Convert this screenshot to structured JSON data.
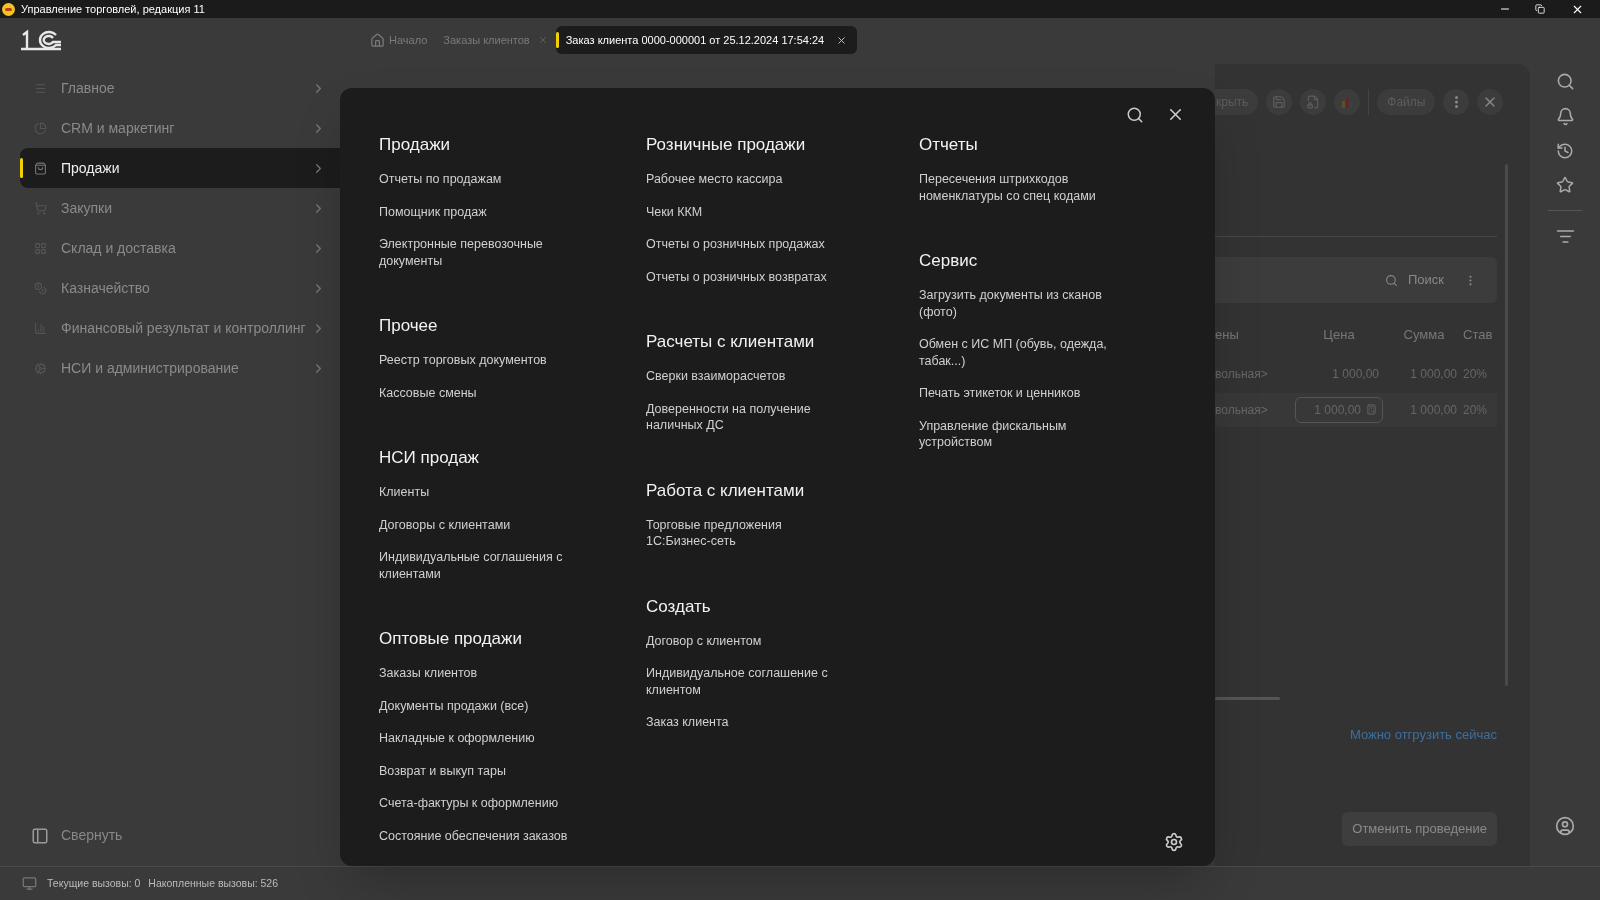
{
  "window": {
    "title": "Управление торговлей, редакция 11"
  },
  "tabs": [
    {
      "label": "Начало",
      "kind": "home",
      "selected": false
    },
    {
      "label": "Заказы клиентов",
      "kind": "plain",
      "selected": false
    },
    {
      "label": "Заказ клиента 0000-000001 от 25.12.2024 17:54:24",
      "kind": "plain",
      "selected": true
    }
  ],
  "sidebar": {
    "items": [
      {
        "label": "Главное",
        "selected": false
      },
      {
        "label": "CRM и маркетинг",
        "selected": false
      },
      {
        "label": "Продажи",
        "selected": true
      },
      {
        "label": "Закупки",
        "selected": false
      },
      {
        "label": "Склад и доставка",
        "selected": false
      },
      {
        "label": "Казначейство",
        "selected": false
      },
      {
        "label": "Финансовый результат и контроллинг",
        "selected": false
      },
      {
        "label": "НСИ и администрирование",
        "selected": false
      }
    ],
    "collapse": "Свернуть"
  },
  "menu_panel": {
    "columns": [
      [
        {
          "title": "Продажи",
          "items": [
            "Отчеты по продажам",
            "Помощник продаж",
            "Электронные перевозочные документы"
          ]
        },
        {
          "title": "Прочее",
          "items": [
            "Реестр торговых документов",
            "Кассовые смены"
          ]
        },
        {
          "title": "НСИ продаж",
          "items": [
            "Клиенты",
            "Договоры с клиентами",
            "Индивидуальные соглашения с клиентами"
          ]
        },
        {
          "title": "Оптовые продажи",
          "items": [
            "Заказы клиентов",
            "Документы продажи (все)",
            "Накладные к оформлению",
            "Возврат и выкуп тары",
            "Счета-фактуры к оформлению",
            "Состояние обеспечения заказов"
          ]
        }
      ],
      [
        {
          "title": "Розничные продажи",
          "items": [
            "Рабочее место кассира",
            "Чеки ККМ",
            "Отчеты о розничных продажах",
            "Отчеты о розничных возвратах"
          ]
        },
        {
          "title": "Расчеты с клиентами",
          "items": [
            "Сверки взаиморасчетов",
            "Доверенности на получение наличных ДС"
          ]
        },
        {
          "title": "Работа с клиентами",
          "items": [
            "Торговые предложения 1С:Бизнес-сеть"
          ]
        },
        {
          "title": "Создать",
          "items": [
            "Договор с клиентом",
            "Индивидуальное соглашение с клиентом",
            "Заказ клиента"
          ]
        }
      ],
      [
        {
          "title": "Отчеты",
          "items": [
            "Пересечения штрихкодов номенклатуры со спец кодами"
          ]
        },
        {
          "title": "Сервис",
          "items": [
            "Загрузить документы из сканов (фото)",
            "Обмен с ИС МП (обувь, одежда, табак...)",
            "Печать этикеток и ценников",
            "Управление фискальным устройством"
          ]
        }
      ]
    ]
  },
  "document": {
    "toolbar": {
      "post_button": "крыть",
      "files_button": "Файлы"
    },
    "search": {
      "placeholder": "Поиск"
    },
    "table": {
      "columns": [
        "ены",
        "Цена",
        "Сумма",
        "Став"
      ],
      "rows": [
        {
          "cells": [
            "вольная>",
            "1 000,00",
            "1 000,00",
            "20%"
          ],
          "editing": false
        },
        {
          "cells": [
            "вольная>",
            "1 000,00",
            "1 000,00",
            "20%"
          ],
          "editing": true
        }
      ]
    },
    "link": "Можно отгрузить сейчас",
    "cancel_button": "Отменить проведение"
  },
  "status_bar": {
    "current_calls": "Текущие вызовы: 0",
    "total_calls": "Накопленные вызовы: 526"
  }
}
